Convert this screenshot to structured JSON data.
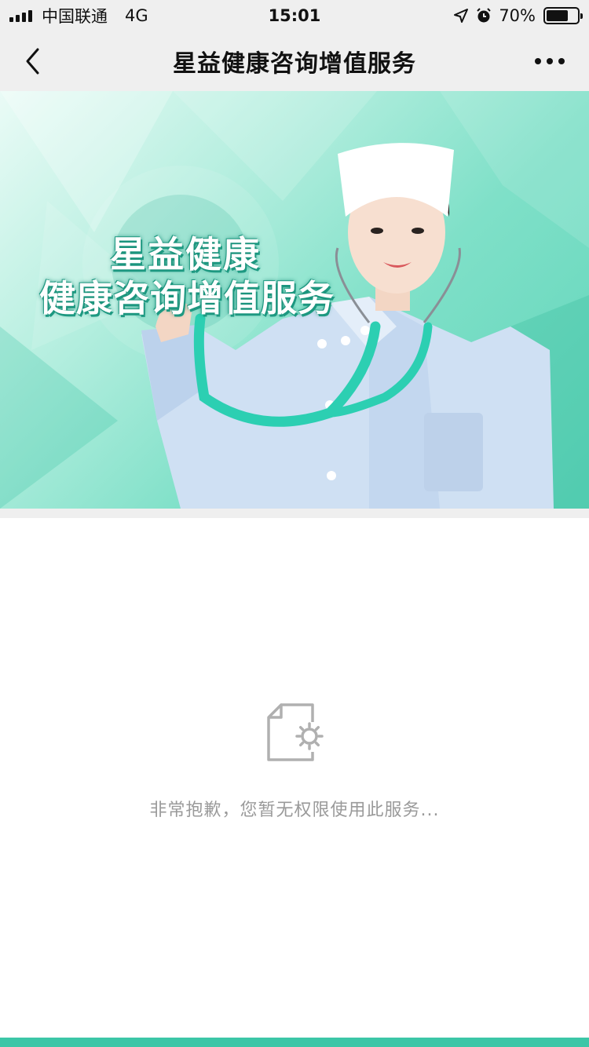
{
  "status_bar": {
    "carrier": "中国联通",
    "network": "4G",
    "time": "15:01",
    "battery_percent": "70%",
    "battery_level": 0.7
  },
  "nav": {
    "title": "星益健康咨询增值服务"
  },
  "banner": {
    "line1": "星益健康",
    "line2": "健康咨询增值服务"
  },
  "empty_state": {
    "icon": "document-gear-icon",
    "message": "非常抱歉，您暂无权限使用此服务..."
  },
  "colors": {
    "accent": "#3cc6a7",
    "nav_background": "#efefef",
    "message_text": "#9a9a9a"
  }
}
